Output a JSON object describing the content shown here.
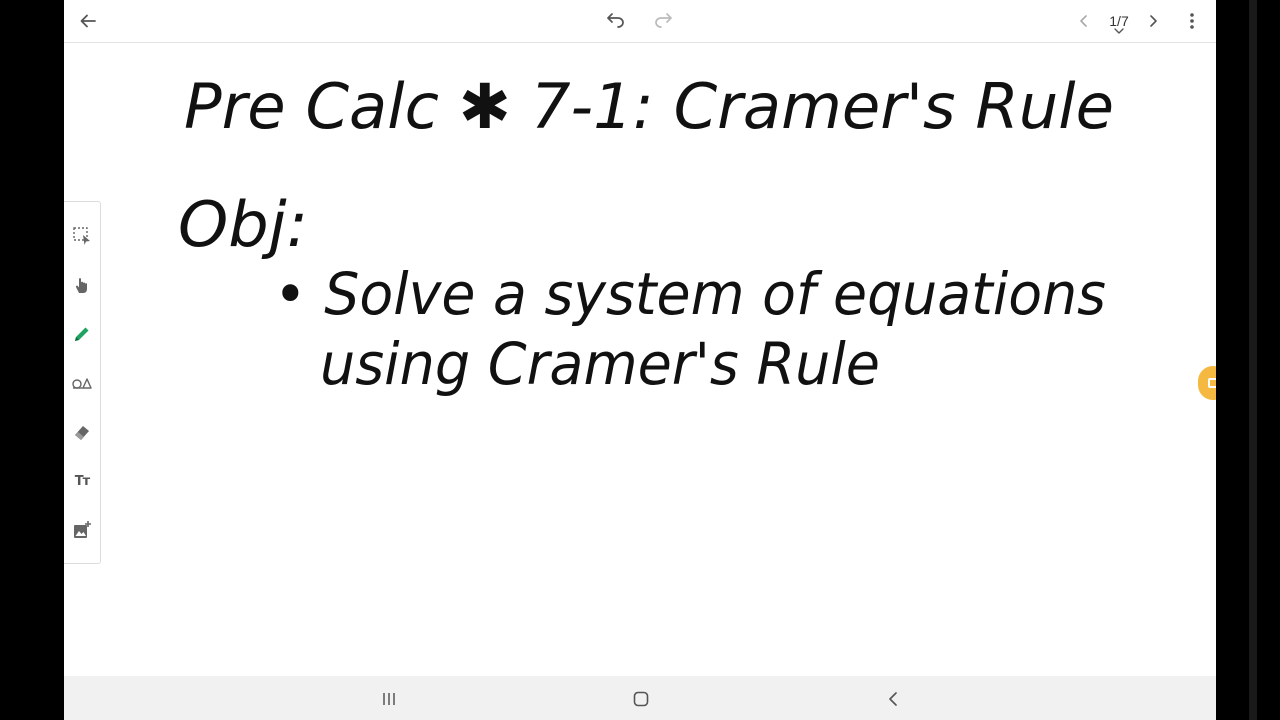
{
  "top_bar": {
    "back_icon": "arrow-left-icon",
    "undo_icon": "undo-icon",
    "redo_icon": "redo-icon",
    "prev_page_icon": "chevron-left-icon",
    "page_counter": "1/7",
    "next_page_icon": "chevron-right-icon",
    "more_icon": "more-vertical-icon"
  },
  "palette": {
    "tools": [
      {
        "id": "lasso-select",
        "icon": "lasso-select-icon"
      },
      {
        "id": "hand",
        "icon": "hand-icon"
      },
      {
        "id": "pen",
        "icon": "pen-icon",
        "active": true
      },
      {
        "id": "shapes",
        "icon": "shapes-icon"
      },
      {
        "id": "eraser",
        "icon": "eraser-icon"
      },
      {
        "id": "text",
        "icon": "text-icon",
        "label": "Tт"
      },
      {
        "id": "insert-image",
        "icon": "add-image-icon"
      }
    ],
    "active_color": "#1ea362"
  },
  "notes": {
    "title_line": "Pre Calc ✱ 7-1: Cramer's Rule",
    "objective_label": "Obj:",
    "objective_line_1": "• Solve a system of equations",
    "objective_line_2": "using Cramer's Rule"
  },
  "nav_bar": {
    "recents_icon": "recents-icon",
    "home_icon": "home-icon",
    "back_icon": "nav-back-icon"
  },
  "colors": {
    "ink": "#111111",
    "icon": "#666666",
    "handle": "#f5b942"
  }
}
